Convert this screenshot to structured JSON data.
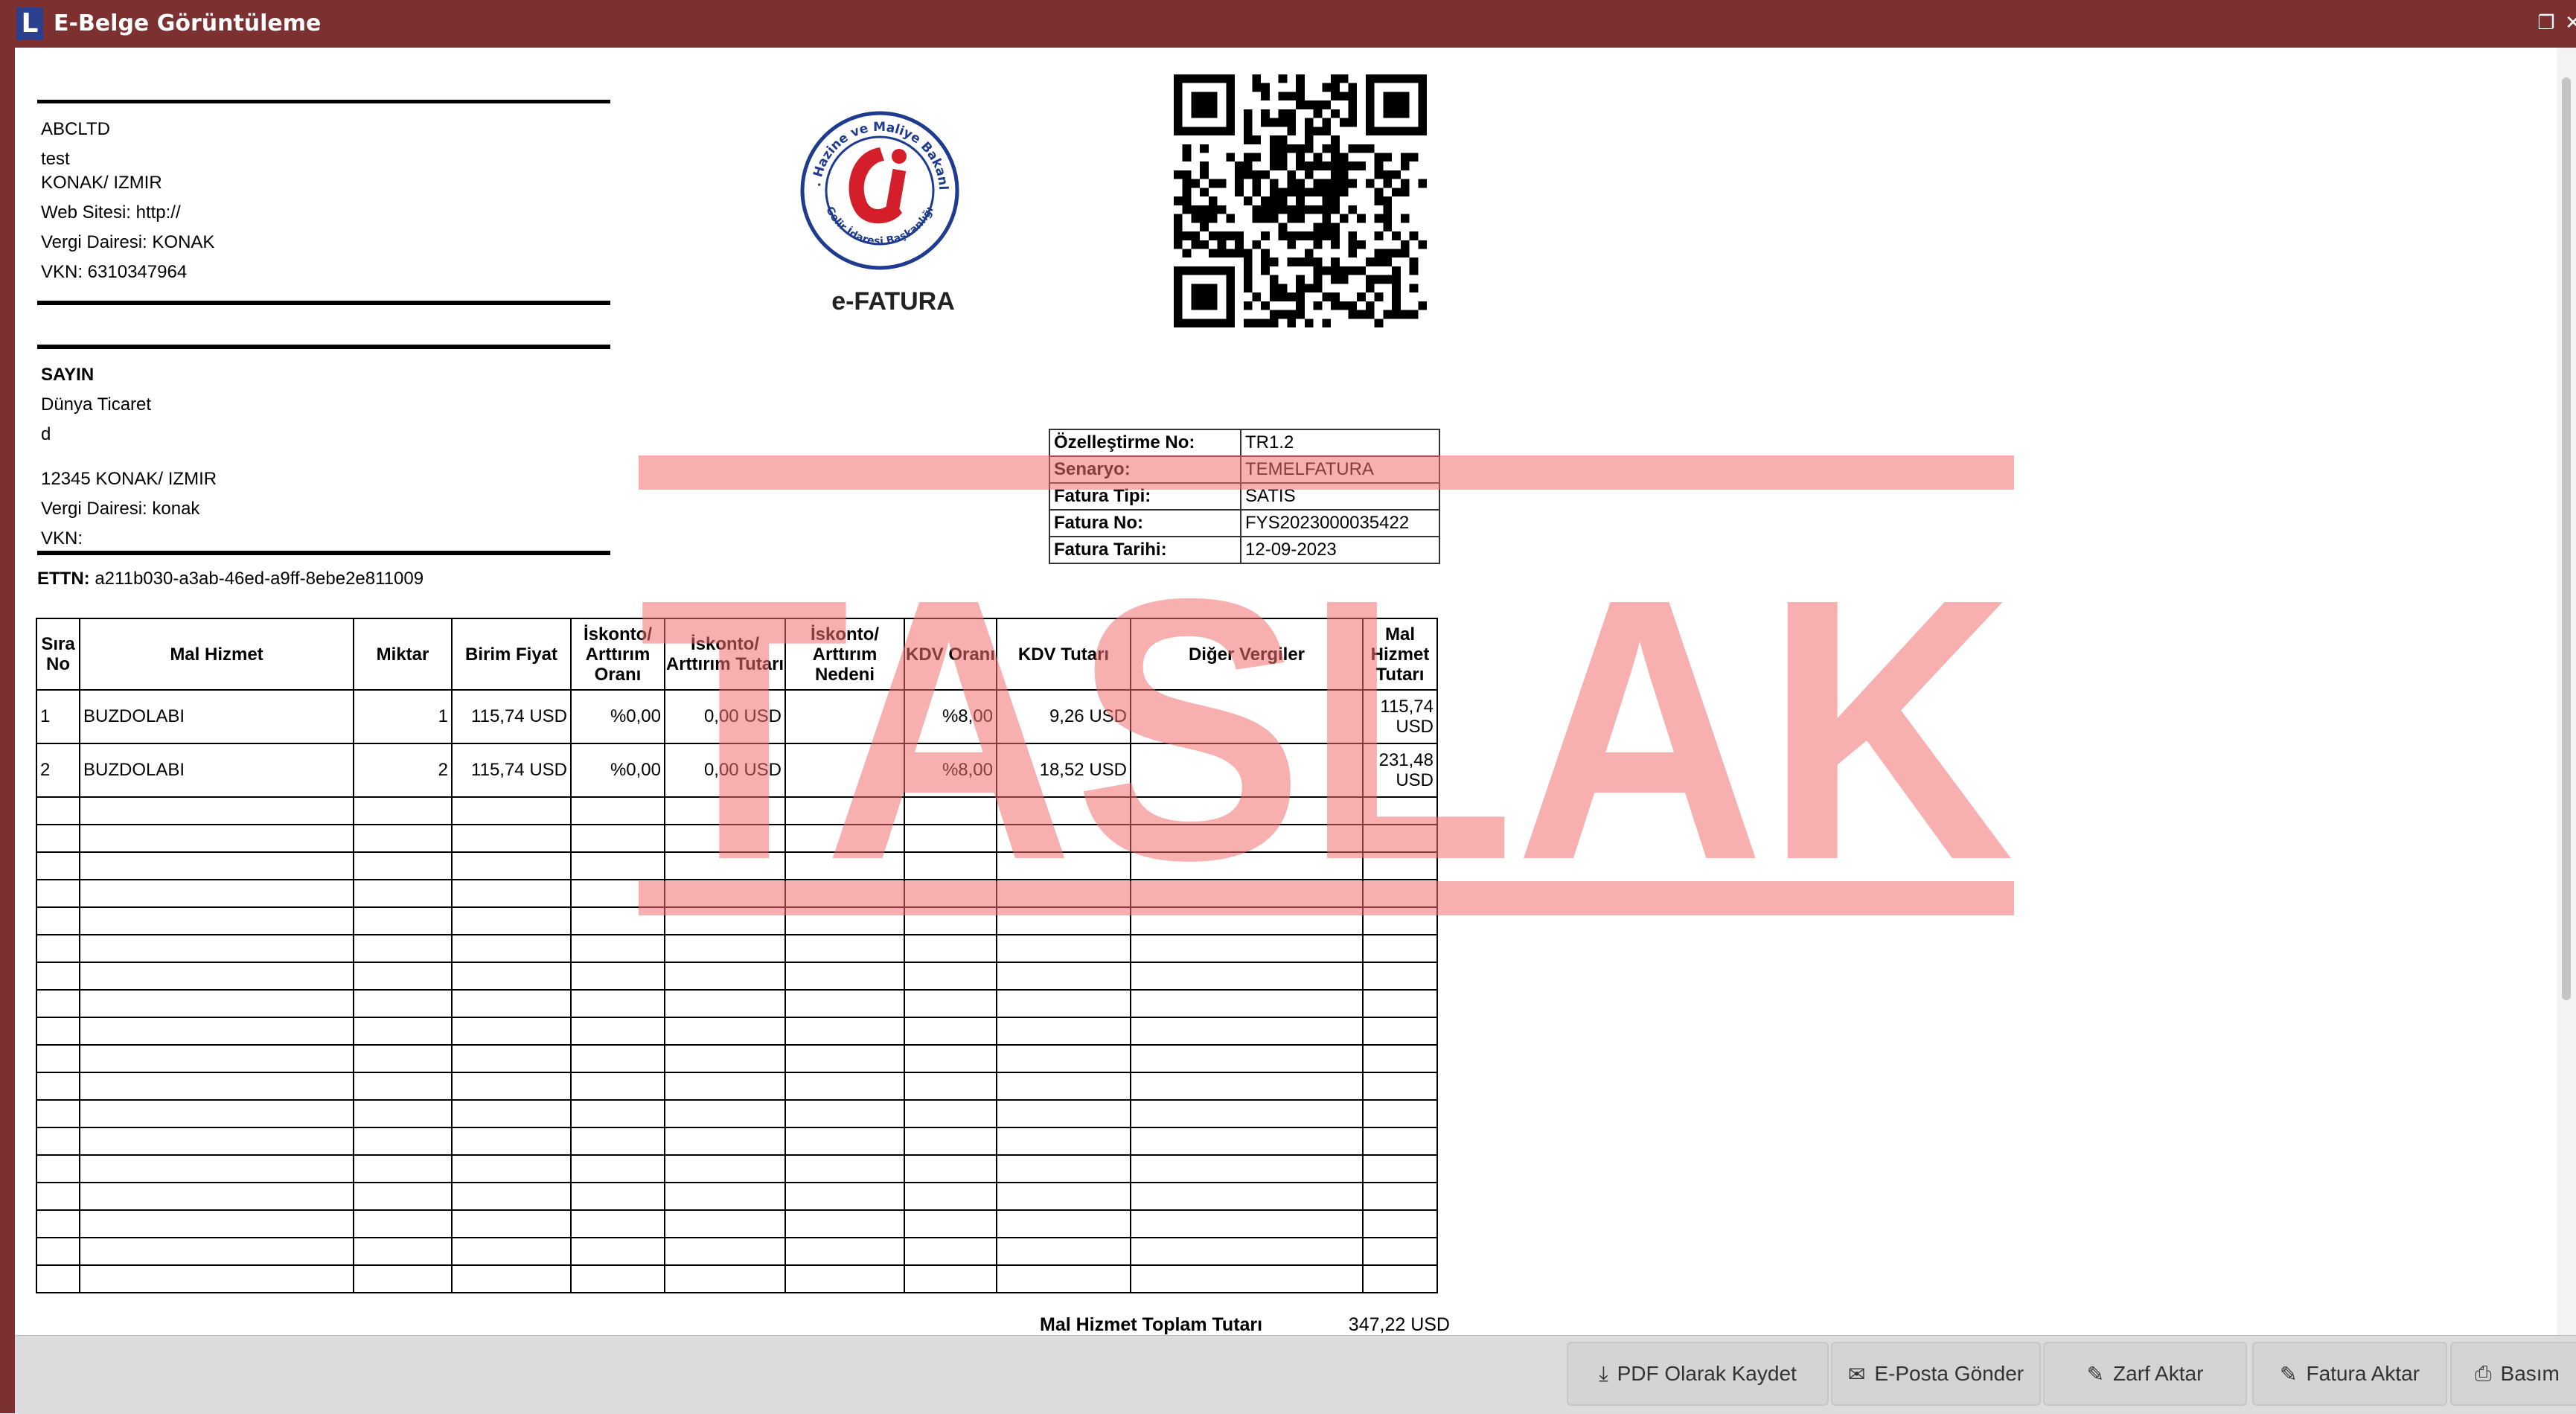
{
  "window": {
    "title": "E-Belge Görüntüleme",
    "app_icon_letter": "L",
    "icons": [
      "restore-icon",
      "close-icon"
    ]
  },
  "sender": {
    "name": "ABCLTD",
    "line1": "test",
    "address": "KONAK/ IZMIR",
    "website": "Web Sitesi: http://",
    "tax_office": "Vergi Dairesi: KONAK",
    "vkn": "VKN: 6310347964"
  },
  "receiver": {
    "salutation": "SAYIN",
    "name": "Dünya Ticaret",
    "line1": "d",
    "address": "12345 KONAK/ IZMIR",
    "tax_office": "Vergi Dairesi: konak",
    "vkn": "VKN:"
  },
  "ettn": {
    "label": "ETTN:",
    "value": "a211b030-a3ab-46ed-a9ff-8ebe2e811009"
  },
  "logo": {
    "ring_text": "T.C. Hazine ve Maliye Bakanlığı",
    "ring_text_bottom": "Gelir İdaresi Başkanlığı",
    "caption": "e-FATURA"
  },
  "info_table": [
    {
      "key": "Özelleştirme No:",
      "value": "TR1.2"
    },
    {
      "key": "Senaryo:",
      "value": "TEMELFATURA"
    },
    {
      "key": "Fatura Tipi:",
      "value": "SATIS"
    },
    {
      "key": "Fatura No:",
      "value": "FYS2023000035422"
    },
    {
      "key": "Fatura Tarihi:",
      "value": "12-09-2023"
    }
  ],
  "items_table": {
    "headers": [
      "Sıra No",
      "Mal Hizmet",
      "Miktar",
      "Birim Fiyat",
      "İskonto/ Arttırım Oranı",
      "İskonto/ Arttırım Tutarı",
      "İskonto/ Arttırım Nedeni",
      "KDV Oranı",
      "KDV Tutarı",
      "Diğer Vergiler",
      "Mal Hizmet Tutarı"
    ],
    "rows": [
      [
        "1",
        "BUZDOLABI",
        "1",
        "115,74 USD",
        "%0,00",
        "0,00 USD",
        "",
        "%8,00",
        "9,26 USD",
        "",
        "115,74 USD"
      ],
      [
        "2",
        "BUZDOLABI",
        "2",
        "115,74 USD",
        "%0,00",
        "0,00 USD",
        "",
        "%8,00",
        "18,52 USD",
        "",
        "231,48 USD"
      ]
    ],
    "empty_rows": 18
  },
  "totals": {
    "label": "Mal Hizmet Toplam Tutarı",
    "value": "347,22 USD"
  },
  "watermark": {
    "text": "TASLAK",
    "color": "#f26d6d"
  },
  "buttons": [
    {
      "label": "PDF Olarak Kaydet",
      "icon": "download-icon"
    },
    {
      "label": "E-Posta Gönder",
      "icon": "envelope-icon"
    },
    {
      "label": "Zarf Aktar",
      "icon": "document-edit-icon"
    },
    {
      "label": "Fatura Aktar",
      "icon": "document-edit-icon"
    },
    {
      "label": "Basım",
      "icon": "printer-icon"
    }
  ],
  "colors": {
    "titlebar": "#7d3030",
    "watermark": "#f26d6d"
  }
}
